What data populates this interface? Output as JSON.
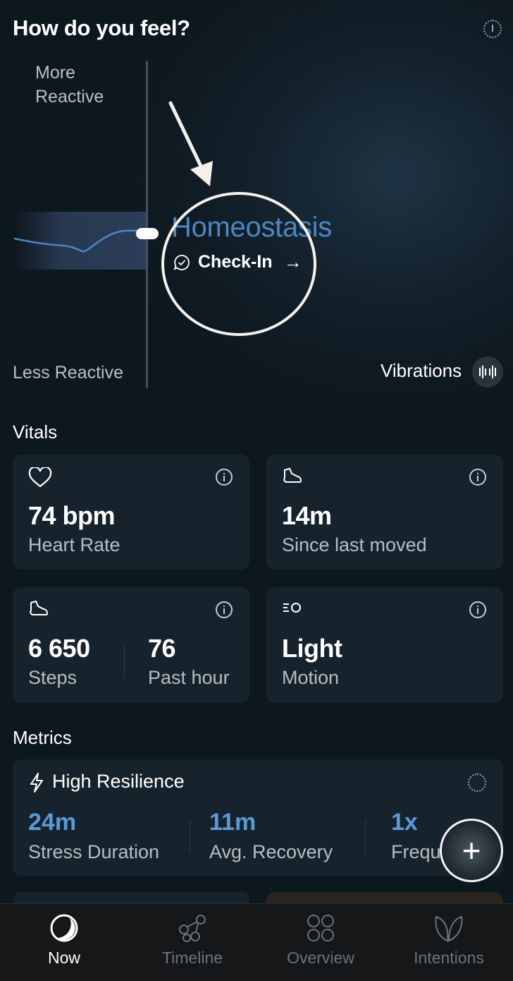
{
  "header": {
    "title": "How do you feel?",
    "settings_icon": "dotted-info-icon"
  },
  "graph": {
    "top_label": "More Reactive",
    "bottom_label": "Less Reactive",
    "state": "Homeostasis",
    "checkin_label": "Check-In",
    "checkin_arrow": "→",
    "vibrations_label": "Vibrations"
  },
  "vitals": {
    "title": "Vitals",
    "heart_rate": {
      "value": "74 bpm",
      "label": "Heart Rate",
      "icon": "heart-icon"
    },
    "last_moved": {
      "value": "14m",
      "label": "Since last moved",
      "icon": "shoe-icon"
    },
    "steps": {
      "value": "6 650",
      "label": "Steps",
      "hour_value": "76",
      "hour_label": "Past hour",
      "icon": "shoe-icon"
    },
    "motion": {
      "value": "Light",
      "label": "Motion",
      "icon": "motion-icon"
    }
  },
  "metrics": {
    "title": "Metrics",
    "resilience": {
      "title": "High Resilience",
      "icon": "lightning-icon",
      "items": [
        {
          "value": "24m",
          "label": "Stress Duration"
        },
        {
          "value": "11m",
          "label": "Avg. Recovery"
        },
        {
          "value": "1x",
          "label": "Frequ"
        }
      ]
    }
  },
  "fab": {
    "label": "+"
  },
  "nav": [
    {
      "label": "Now",
      "icon": "moon-icon",
      "active": true
    },
    {
      "label": "Timeline",
      "icon": "timeline-icon",
      "active": false
    },
    {
      "label": "Overview",
      "icon": "grid-icon",
      "active": false
    },
    {
      "label": "Intentions",
      "icon": "leaf-icon",
      "active": false
    }
  ],
  "colors": {
    "accent": "#5b9ad7",
    "state": "#4d86c4",
    "card": "#16232d",
    "background": "#0f1a22"
  }
}
